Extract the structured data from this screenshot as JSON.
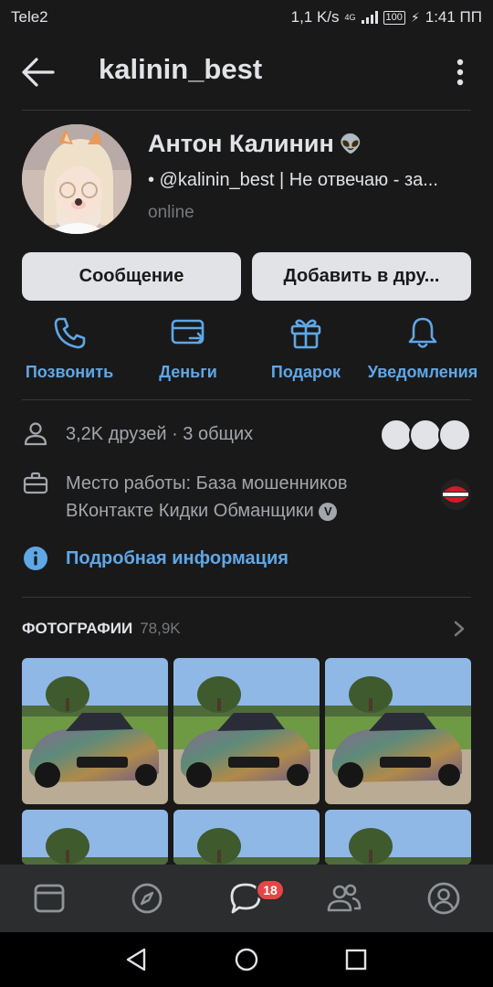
{
  "status_bar": {
    "carrier": "Tele2",
    "speed": "1,1 K/s",
    "network": "4G",
    "battery": "100",
    "time": "1:41 ПП"
  },
  "header": {
    "title": "kalinin_best",
    "back_icon": "arrow-left-icon",
    "more_icon": "more-vertical-icon"
  },
  "profile": {
    "name": "Антон Калинин",
    "name_emoji": "👽",
    "status": "• @kalinin_best | Не отвечаю - за...",
    "online": "online"
  },
  "buttons": {
    "message": "Сообщение",
    "add_friend": "Добавить в дру..."
  },
  "actions": [
    {
      "label": "Позвонить",
      "icon": "phone-icon"
    },
    {
      "label": "Деньги",
      "icon": "money-transfer-icon"
    },
    {
      "label": "Подарок",
      "icon": "gift-icon"
    },
    {
      "label": "Уведомления",
      "icon": "bell-icon"
    }
  ],
  "info": {
    "friends": "3,2K друзей · 3 общих",
    "work_line1": "Место работы: База мошенников",
    "work_line2": "ВКонтакте  Кидки Обманщики",
    "verified_mark": "V",
    "more_info": "Подробная информация"
  },
  "photos": {
    "title": "ФОТОГРАФИИ",
    "count": "78,9K"
  },
  "tabbar": {
    "items": [
      "feed-icon",
      "discover-icon",
      "messages-icon",
      "friends-icon",
      "profile-icon"
    ],
    "messages_badge": "18"
  },
  "colors": {
    "background": "#19191a",
    "accent": "#5fa7e6",
    "text_primary": "#e1e3e6",
    "text_secondary": "#a3a6aa",
    "badge": "#e64646"
  }
}
